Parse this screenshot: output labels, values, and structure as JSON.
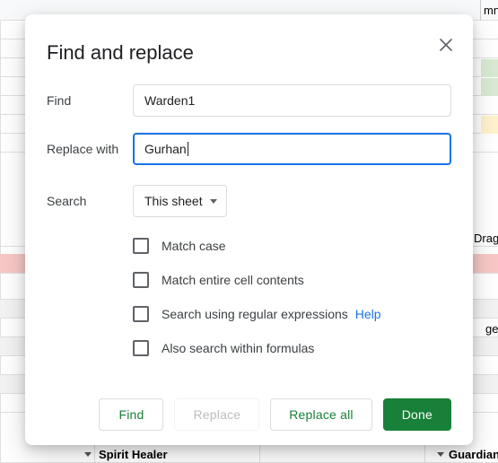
{
  "dialog": {
    "title": "Find and replace",
    "find_label": "Find",
    "find_value": "Warden1",
    "replace_label": "Replace with",
    "replace_value": "Gurhan",
    "search_label": "Search",
    "search_scope": "This sheet",
    "options": {
      "match_case": "Match case",
      "match_cell": "Match entire cell contents",
      "regex": "Search using regular expressions",
      "regex_help": "Help",
      "formulas": "Also search within formulas"
    },
    "buttons": {
      "find": "Find",
      "replace": "Replace",
      "replace_all": "Replace all",
      "done": "Done"
    }
  },
  "background": {
    "header_fragment_right": "mn",
    "cell_drag_right": "Drag",
    "cell_ige_right": "ge",
    "cell_guardian": "Guardian",
    "cell_spirit_healer": "Spirit Healer"
  }
}
